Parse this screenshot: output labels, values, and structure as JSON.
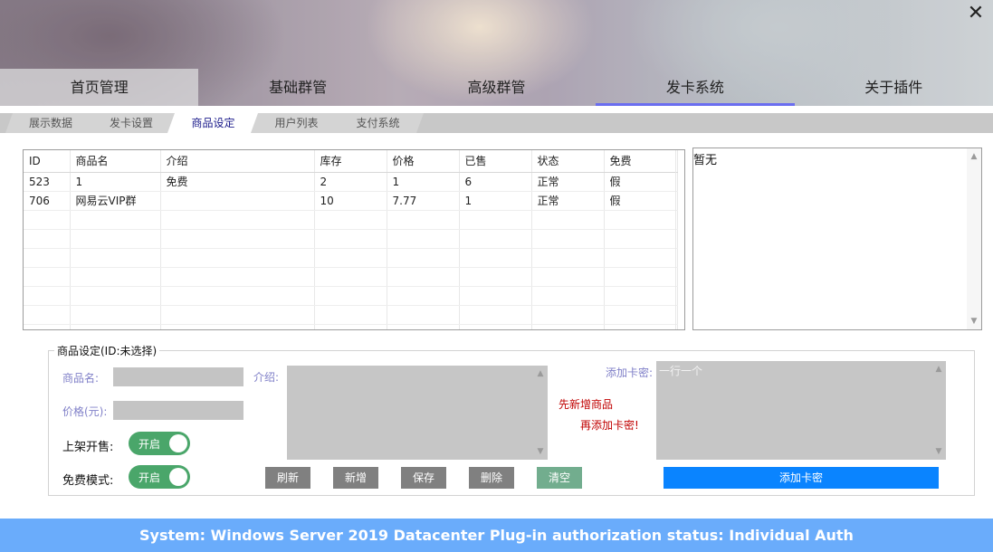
{
  "window": {
    "close_glyph": "✕"
  },
  "main_tabs": [
    {
      "label": "首页管理"
    },
    {
      "label": "基础群管"
    },
    {
      "label": "高级群管"
    },
    {
      "label": "发卡系统"
    },
    {
      "label": "关于插件"
    }
  ],
  "sub_tabs": [
    {
      "label": "展示数据"
    },
    {
      "label": "发卡设置"
    },
    {
      "label": "商品设定"
    },
    {
      "label": "用户列表"
    },
    {
      "label": "支付系统"
    }
  ],
  "grid": {
    "headers": [
      "ID",
      "商品名",
      "介绍",
      "库存",
      "价格",
      "已售",
      "状态",
      "免费"
    ],
    "rows": [
      [
        "523",
        "1",
        "免费",
        "2",
        "1",
        "6",
        "正常",
        "假"
      ],
      [
        "706",
        "网易云VIP群",
        "",
        "10",
        "7.77",
        "1",
        "正常",
        "假"
      ]
    ]
  },
  "note_box": {
    "text": "暂无"
  },
  "product_form": {
    "group_title": "商品设定(ID:未选择)",
    "name_label": "商品名:",
    "price_label": "价格(元):",
    "intro_label": "介绍:",
    "on_sale_label": "上架开售:",
    "on_sale_toggle": "开启",
    "free_mode_label": "免费模式:",
    "free_mode_toggle": "开启",
    "card_label": "添加卡密:",
    "card_placeholder": "一行一个",
    "hint_line1": "先新增商品",
    "hint_line2": "再添加卡密!",
    "buttons": {
      "refresh": "刷新",
      "add": "新增",
      "save": "保存",
      "delete": "删除",
      "clear": "清空",
      "add_card": "添加卡密"
    }
  },
  "status_bar": {
    "text": "System:  Windows Server 2019 Datacenter  Plug-in authorization status:  Individual Auth"
  },
  "colors": {
    "status_bar": "#6aacfb",
    "toggle_on": "#4aa66a",
    "primary_button": "#0a84ff",
    "hint_text": "#c00000",
    "tab_underline": "#6a6df0"
  }
}
